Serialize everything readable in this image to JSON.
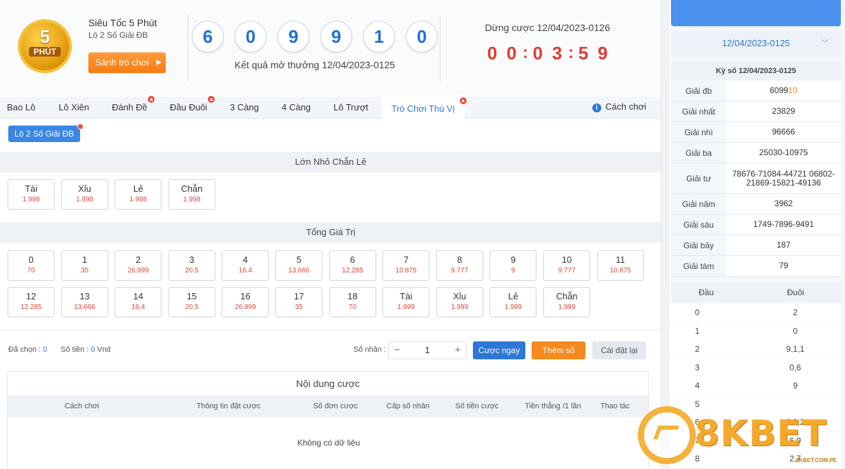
{
  "header": {
    "logo_number": "5",
    "logo_text": "PHÚT",
    "game_title": "Siêu Tốc 5 Phút",
    "game_subtitle": "Lô 2 Số Giải ĐB",
    "lobby_button": "Sảnh trò chơi",
    "result_balls": [
      "6",
      "0",
      "9",
      "9",
      "1",
      "0"
    ],
    "result_label": "Kết quả mở thưởng 12/04/2023-0125",
    "stop_label": "Dừng cược 12/04/2023-0126",
    "countdown": [
      "0",
      "0",
      "0",
      "3",
      "5",
      "9"
    ]
  },
  "tabs": [
    {
      "label": "Bao Lô",
      "badge": false
    },
    {
      "label": "Lô Xiên",
      "badge": false
    },
    {
      "label": "Đánh Đề",
      "badge": true
    },
    {
      "label": "Đầu Đuôi",
      "badge": true
    },
    {
      "label": "3 Càng",
      "badge": false
    },
    {
      "label": "4 Càng",
      "badge": false
    },
    {
      "label": "Lô Trượt",
      "badge": false
    },
    {
      "label": "Trò Chơi Thú Vị",
      "badge": true,
      "active": true
    }
  ],
  "help_label": "Cách chơi",
  "subtab_label": "Lô 2 Số Giải ĐB",
  "section1": {
    "title": "Lớn Nhỏ Chẵn Lẻ",
    "options": [
      {
        "label": "Tài",
        "odds": "1.998"
      },
      {
        "label": "Xỉu",
        "odds": "1.998"
      },
      {
        "label": "Lẻ",
        "odds": "1.998"
      },
      {
        "label": "Chẵn",
        "odds": "1.998"
      }
    ]
  },
  "section2": {
    "title": "Tổng Giá Trị",
    "row1": [
      {
        "label": "0",
        "odds": "70"
      },
      {
        "label": "1",
        "odds": "35"
      },
      {
        "label": "2",
        "odds": "26.999"
      },
      {
        "label": "3",
        "odds": "20.5"
      },
      {
        "label": "4",
        "odds": "16.4"
      },
      {
        "label": "5",
        "odds": "13.666"
      },
      {
        "label": "6",
        "odds": "12.285"
      },
      {
        "label": "7",
        "odds": "10.875"
      },
      {
        "label": "8",
        "odds": "9.777"
      },
      {
        "label": "9",
        "odds": "9"
      },
      {
        "label": "10",
        "odds": "9.777"
      },
      {
        "label": "11",
        "odds": "10.875"
      }
    ],
    "row2": [
      {
        "label": "12",
        "odds": "12.285"
      },
      {
        "label": "13",
        "odds": "13.666"
      },
      {
        "label": "14",
        "odds": "16.4"
      },
      {
        "label": "15",
        "odds": "20.5"
      },
      {
        "label": "16",
        "odds": "26.999"
      },
      {
        "label": "17",
        "odds": "35"
      },
      {
        "label": "18",
        "odds": "70"
      },
      {
        "label": "Tài",
        "odds": "1.999"
      },
      {
        "label": "Xỉu",
        "odds": "1.999"
      },
      {
        "label": "Lẻ",
        "odds": "1.999"
      },
      {
        "label": "Chẵn",
        "odds": "1.999"
      }
    ]
  },
  "betbar": {
    "selected_label": "Đã chọn : ",
    "selected_value": "0",
    "money_label": "Số tiền : ",
    "money_value": "0",
    "money_unit": " Vnd",
    "multiplier_label": "Số nhân :",
    "multiplier_value": "1",
    "minus": "−",
    "plus": "+",
    "bet_now": "Cược ngay",
    "add_number": "Thêm số",
    "reset": "Cài đặt lại"
  },
  "content": {
    "title": "Nội dung cược",
    "columns": [
      "Cách chơi",
      "Thông tin đặt cược",
      "Số đơn cược",
      "Cấp số nhân",
      "Số tiền cược",
      "Tiền thắng /1 lần",
      "Thao tác"
    ],
    "empty": "Không có dữ liệu"
  },
  "results_panel": {
    "period": "12/04/2023-0125",
    "kyso": "Kỳ số 12/04/2023-0125",
    "special_prefix": "6099",
    "special_highlight": "10",
    "prizes": [
      {
        "name": "Giải đb"
      },
      {
        "name": "Giải nhất",
        "value": "23829"
      },
      {
        "name": "Giải nhì",
        "value": "96666"
      },
      {
        "name": "Giải ba",
        "value": "25030-10975"
      },
      {
        "name": "Giải tư",
        "value": "78676-71084-44721 06802-21869-15821-49136"
      },
      {
        "name": "Giải năm",
        "value": "3962"
      },
      {
        "name": "Giải sáu",
        "value": "1749-7896-9491"
      },
      {
        "name": "Giải bảy",
        "value": "187"
      },
      {
        "name": "Giải tám",
        "value": "79"
      }
    ],
    "dau_label": "Đầu",
    "duoi_label": "Đuôi",
    "dau_duoi": [
      {
        "dau": "0",
        "duoi": "2"
      },
      {
        "dau": "1",
        "duoi": "0"
      },
      {
        "dau": "2",
        "duoi": "9,1,1"
      },
      {
        "dau": "3",
        "duoi": "0,6"
      },
      {
        "dau": "4",
        "duoi": "9"
      },
      {
        "dau": "5",
        "duoi": ""
      },
      {
        "dau": "6",
        "duoi": "6,9,2"
      },
      {
        "dau": "7",
        "duoi": "6,9"
      },
      {
        "dau": "8",
        "duoi": "2,7"
      }
    ]
  },
  "brand": {
    "name": "8KBET",
    "url": "8KBET.COM.PE"
  },
  "colors": {
    "primary": "#2c77d8",
    "accent": "#f68a1f",
    "odds": "#d9473b",
    "countdown": "#e03c31"
  }
}
